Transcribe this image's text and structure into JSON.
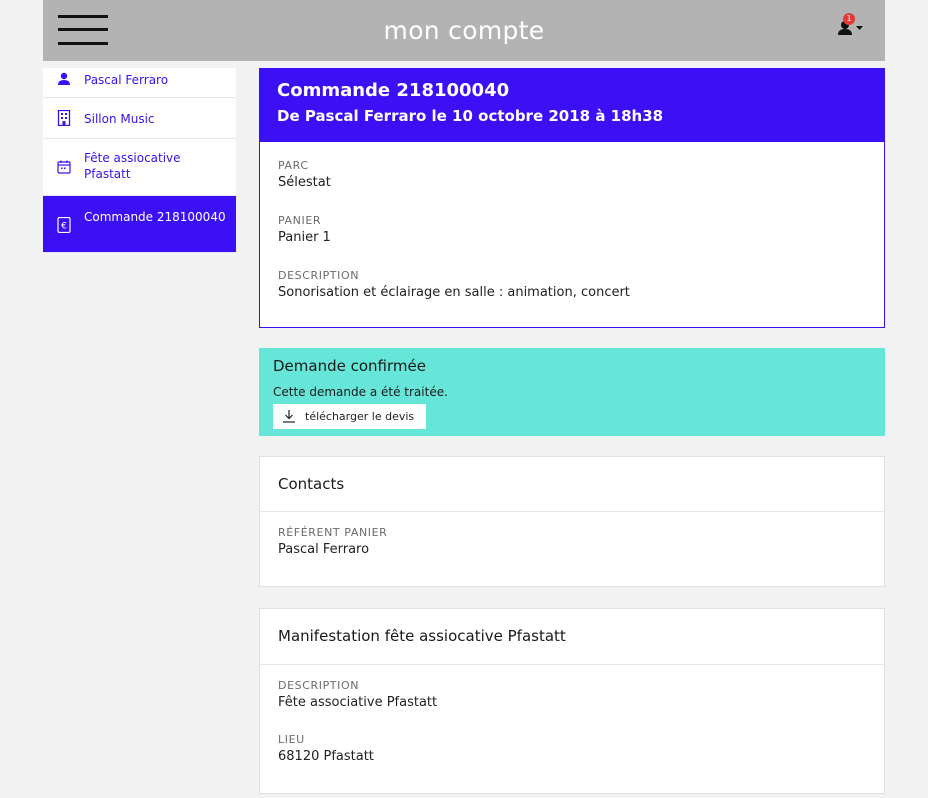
{
  "header": {
    "title": "mon compte",
    "notification_count": "1"
  },
  "sidebar": {
    "items": [
      {
        "label": "Pascal Ferraro",
        "icon": "user-icon"
      },
      {
        "label": "Sillon Music",
        "icon": "building-icon"
      },
      {
        "label": "Fête assiocative Pfastatt",
        "icon": "calendar-icon"
      },
      {
        "label": "Commande 218100040",
        "icon": "euro-icon",
        "active": true
      }
    ]
  },
  "order": {
    "title": "Commande 218100040",
    "subtitle": "De Pascal Ferraro le 10 octobre 2018 à 18h38",
    "fields": [
      {
        "label": "PARC",
        "value": "Sélestat"
      },
      {
        "label": "PANIER",
        "value": "Panier 1"
      },
      {
        "label": "DESCRIPTION",
        "value": "Sonorisation et éclairage en salle : animation, concert"
      }
    ]
  },
  "status": {
    "title": "Demande confirmée",
    "text": "Cette demande a été traitée.",
    "download_label": "télécharger le devis"
  },
  "contacts": {
    "title": "Contacts",
    "label": "RÉFÉRENT PANIER",
    "value": "Pascal Ferraro"
  },
  "event": {
    "title": "Manifestation fête assiocative Pfastatt",
    "fields": [
      {
        "label": "DESCRIPTION",
        "value": "Fête associative Pfastatt"
      },
      {
        "label": "LIEU",
        "value": "68120 Pfastatt"
      }
    ]
  },
  "colors": {
    "accent": "#3b10f5",
    "success": "#66e6d8",
    "header": "#b3b3b3"
  }
}
